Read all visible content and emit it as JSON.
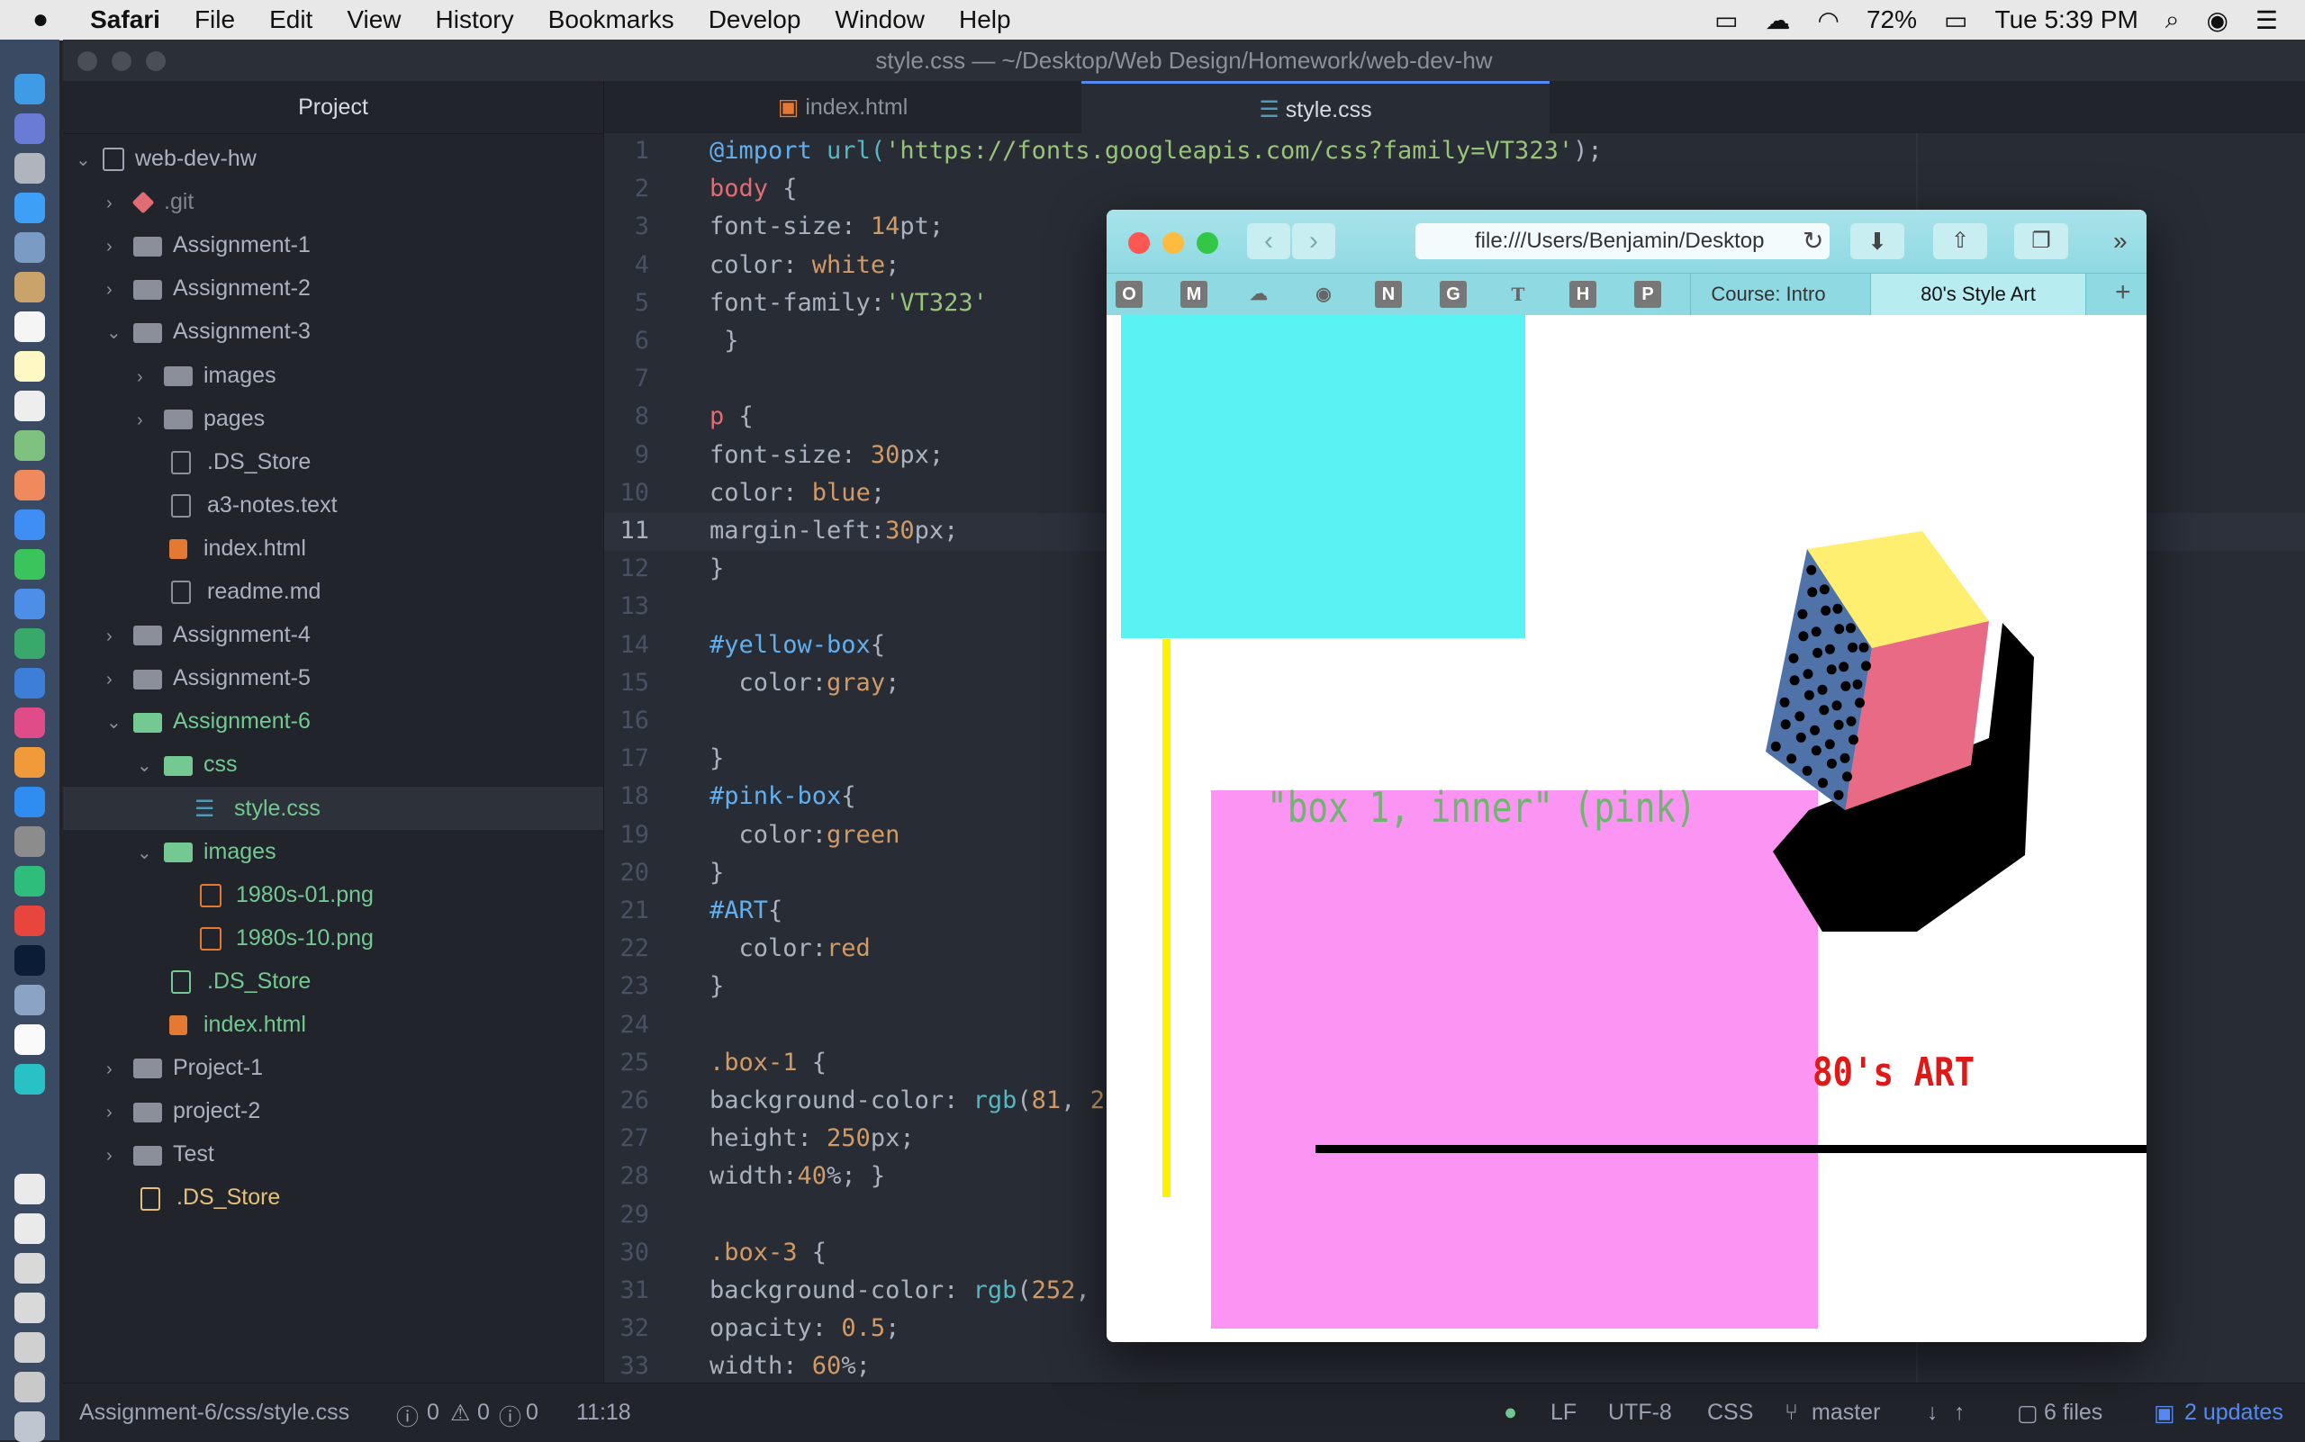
{
  "menubar": {
    "apple_icon": "apple-icon",
    "app": "Safari",
    "items": [
      "File",
      "Edit",
      "View",
      "History",
      "Bookmarks",
      "Develop",
      "Window",
      "Help"
    ],
    "battery": "72%",
    "clock": "Tue 5:39 PM"
  },
  "atom": {
    "window_title": "style.css — ~/Desktop/Web Design/Homework/web-dev-hw",
    "tree_title": "Project",
    "tree": [
      {
        "label": "web-dev-hw",
        "indent": 0,
        "type": "repo",
        "arrow": "⌄"
      },
      {
        "label": ".git",
        "indent": 1,
        "type": "git",
        "arrow": "›"
      },
      {
        "label": "Assignment-1",
        "indent": 1,
        "type": "folder",
        "arrow": "›"
      },
      {
        "label": "Assignment-2",
        "indent": 1,
        "type": "folder",
        "arrow": "›"
      },
      {
        "label": "Assignment-3",
        "indent": 1,
        "type": "folder",
        "arrow": "⌄"
      },
      {
        "label": "images",
        "indent": 2,
        "type": "folder",
        "arrow": "›"
      },
      {
        "label": "pages",
        "indent": 2,
        "type": "folder",
        "arrow": "›"
      },
      {
        "label": ".DS_Store",
        "indent": 2,
        "type": "file",
        "arrow": ""
      },
      {
        "label": "a3-notes.text",
        "indent": 2,
        "type": "file",
        "arrow": ""
      },
      {
        "label": "index.html",
        "indent": 2,
        "type": "html",
        "arrow": ""
      },
      {
        "label": "readme.md",
        "indent": 2,
        "type": "file",
        "arrow": ""
      },
      {
        "label": "Assignment-4",
        "indent": 1,
        "type": "folder",
        "arrow": "›"
      },
      {
        "label": "Assignment-5",
        "indent": 1,
        "type": "folder",
        "arrow": "›"
      },
      {
        "label": "Assignment-6",
        "indent": 1,
        "type": "folder-g",
        "arrow": "⌄"
      },
      {
        "label": "css",
        "indent": 2,
        "type": "folder-g",
        "arrow": "⌄"
      },
      {
        "label": "style.css",
        "indent": 3,
        "type": "css",
        "arrow": ""
      },
      {
        "label": "images",
        "indent": 2,
        "type": "folder-g",
        "arrow": "⌄"
      },
      {
        "label": "1980s-01.png",
        "indent": 3,
        "type": "img",
        "arrow": ""
      },
      {
        "label": "1980s-10.png",
        "indent": 3,
        "type": "img",
        "arrow": ""
      },
      {
        "label": ".DS_Store",
        "indent": 2,
        "type": "file-g",
        "arrow": ""
      },
      {
        "label": "index.html",
        "indent": 2,
        "type": "html-g",
        "arrow": ""
      },
      {
        "label": "Project-1",
        "indent": 1,
        "type": "folder",
        "arrow": "›"
      },
      {
        "label": "project-2",
        "indent": 1,
        "type": "folder",
        "arrow": "›"
      },
      {
        "label": "Test",
        "indent": 1,
        "type": "folder",
        "arrow": "›"
      },
      {
        "label": ".DS_Store",
        "indent": 1,
        "type": "file-o",
        "arrow": ""
      }
    ],
    "tabs": [
      "index.html",
      "style.css"
    ],
    "code": [
      [
        [
          "@import",
          "c"
        ],
        [
          " url(",
          "f"
        ],
        [
          "'https://fonts.googleapis.com/css?family=VT323'",
          "s"
        ],
        [
          ");",
          ""
        ]
      ],
      [
        [
          "body",
          "k"
        ],
        [
          " {",
          ""
        ]
      ],
      [
        [
          "font-size: ",
          ""
        ],
        [
          "14",
          "n"
        ],
        [
          "pt;",
          ""
        ]
      ],
      [
        [
          "color: ",
          ""
        ],
        [
          "white",
          "n"
        ],
        [
          ";",
          ""
        ]
      ],
      [
        [
          "font-family:",
          ""
        ],
        [
          "'VT323'",
          "s"
        ]
      ],
      [
        [
          " }",
          ""
        ]
      ],
      [
        [
          "",
          ""
        ]
      ],
      [
        [
          "p",
          "k"
        ],
        [
          " {",
          ""
        ]
      ],
      [
        [
          "font-size: ",
          ""
        ],
        [
          "30",
          "n"
        ],
        [
          "px;",
          ""
        ]
      ],
      [
        [
          "color: ",
          ""
        ],
        [
          "blue",
          "n"
        ],
        [
          ";",
          ""
        ]
      ],
      [
        [
          "margin-left:",
          ""
        ],
        [
          "30",
          "n"
        ],
        [
          "px;",
          ""
        ]
      ],
      [
        [
          "}",
          ""
        ]
      ],
      [
        [
          "",
          ""
        ]
      ],
      [
        [
          "#yellow-box",
          "c"
        ],
        [
          "{",
          ""
        ]
      ],
      [
        [
          "  color:",
          ""
        ],
        [
          "gray",
          "n"
        ],
        [
          ";",
          ""
        ]
      ],
      [
        [
          "",
          ""
        ]
      ],
      [
        [
          "}",
          ""
        ]
      ],
      [
        [
          "#pink-box",
          "c"
        ],
        [
          "{",
          ""
        ]
      ],
      [
        [
          "  color:",
          ""
        ],
        [
          "green",
          "n"
        ]
      ],
      [
        [
          "}",
          ""
        ]
      ],
      [
        [
          "#ART",
          "c"
        ],
        [
          "{",
          ""
        ]
      ],
      [
        [
          "  color:",
          ""
        ],
        [
          "red",
          "n"
        ]
      ],
      [
        [
          "}",
          ""
        ]
      ],
      [
        [
          "",
          ""
        ]
      ],
      [
        [
          ".box-1",
          "n"
        ],
        [
          " {",
          ""
        ]
      ],
      [
        [
          "background-color: ",
          ""
        ],
        [
          "rgb",
          "f"
        ],
        [
          "(",
          ""
        ],
        [
          "81",
          "n"
        ],
        [
          ", ",
          ""
        ],
        [
          "2",
          "n"
        ]
      ],
      [
        [
          "height: ",
          ""
        ],
        [
          "250",
          "n"
        ],
        [
          "px;",
          ""
        ]
      ],
      [
        [
          "width:",
          ""
        ],
        [
          "40",
          "n"
        ],
        [
          "%; }",
          ""
        ]
      ],
      [
        [
          "",
          ""
        ]
      ],
      [
        [
          ".box-3",
          "n"
        ],
        [
          " {",
          ""
        ]
      ],
      [
        [
          "background-color: ",
          ""
        ],
        [
          "rgb",
          "f"
        ],
        [
          "(",
          ""
        ],
        [
          "252",
          "n"
        ],
        [
          ",",
          ""
        ]
      ],
      [
        [
          "opacity: ",
          ""
        ],
        [
          "0.5",
          "n"
        ],
        [
          ";",
          ""
        ]
      ],
      [
        [
          "width: ",
          ""
        ],
        [
          "60",
          "n"
        ],
        [
          "%;",
          ""
        ]
      ]
    ],
    "status": {
      "path": "Assignment-6/css/style.css",
      "errors": "0",
      "warnings": "0",
      "info": "0",
      "cursor": "11:18",
      "line_ending": "LF",
      "encoding": "UTF-8",
      "grammar": "CSS",
      "branch": "master",
      "files": "6 files",
      "updates": "2 updates"
    }
  },
  "safari": {
    "url": "file:///Users/Benjamin/Desktop",
    "favorites": [
      "O",
      "M",
      "☁",
      "◉",
      "N",
      "G",
      "T",
      "H",
      "P"
    ],
    "tabs": [
      "Course: Intro",
      "80's Style Art"
    ],
    "page": {
      "pink_text": "\"box 1, inner\" (pink)",
      "art_text": "80's ART"
    }
  },
  "colors": {
    "cyan": "#5af3f3",
    "pink": "#fb94f2",
    "yellow": "#fff200",
    "cube_yellow": "#ffef70",
    "cube_pink": "#e96a84",
    "cube_blue": "#4f72a9"
  }
}
